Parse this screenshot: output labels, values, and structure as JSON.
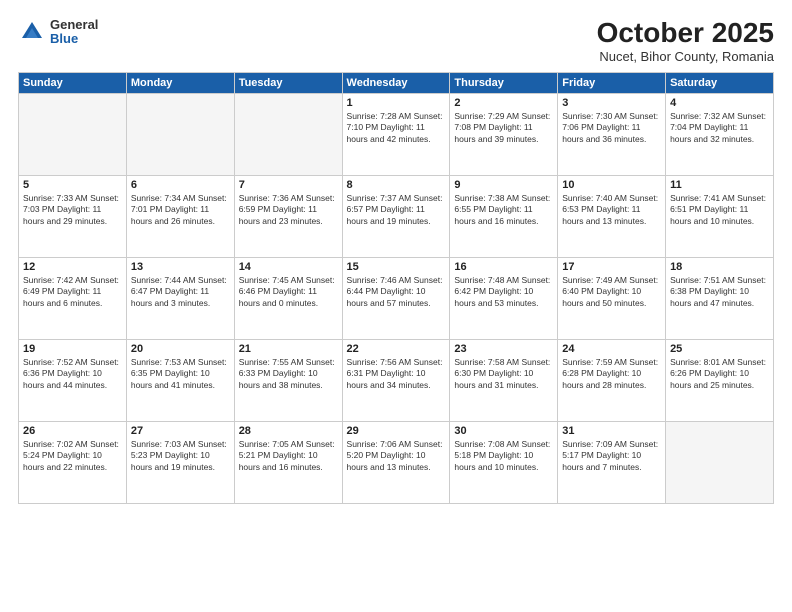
{
  "logo": {
    "general": "General",
    "blue": "Blue"
  },
  "title": "October 2025",
  "location": "Nucet, Bihor County, Romania",
  "days_header": [
    "Sunday",
    "Monday",
    "Tuesday",
    "Wednesday",
    "Thursday",
    "Friday",
    "Saturday"
  ],
  "weeks": [
    [
      {
        "day": "",
        "info": ""
      },
      {
        "day": "",
        "info": ""
      },
      {
        "day": "",
        "info": ""
      },
      {
        "day": "1",
        "info": "Sunrise: 7:28 AM\nSunset: 7:10 PM\nDaylight: 11 hours\nand 42 minutes."
      },
      {
        "day": "2",
        "info": "Sunrise: 7:29 AM\nSunset: 7:08 PM\nDaylight: 11 hours\nand 39 minutes."
      },
      {
        "day": "3",
        "info": "Sunrise: 7:30 AM\nSunset: 7:06 PM\nDaylight: 11 hours\nand 36 minutes."
      },
      {
        "day": "4",
        "info": "Sunrise: 7:32 AM\nSunset: 7:04 PM\nDaylight: 11 hours\nand 32 minutes."
      }
    ],
    [
      {
        "day": "5",
        "info": "Sunrise: 7:33 AM\nSunset: 7:03 PM\nDaylight: 11 hours\nand 29 minutes."
      },
      {
        "day": "6",
        "info": "Sunrise: 7:34 AM\nSunset: 7:01 PM\nDaylight: 11 hours\nand 26 minutes."
      },
      {
        "day": "7",
        "info": "Sunrise: 7:36 AM\nSunset: 6:59 PM\nDaylight: 11 hours\nand 23 minutes."
      },
      {
        "day": "8",
        "info": "Sunrise: 7:37 AM\nSunset: 6:57 PM\nDaylight: 11 hours\nand 19 minutes."
      },
      {
        "day": "9",
        "info": "Sunrise: 7:38 AM\nSunset: 6:55 PM\nDaylight: 11 hours\nand 16 minutes."
      },
      {
        "day": "10",
        "info": "Sunrise: 7:40 AM\nSunset: 6:53 PM\nDaylight: 11 hours\nand 13 minutes."
      },
      {
        "day": "11",
        "info": "Sunrise: 7:41 AM\nSunset: 6:51 PM\nDaylight: 11 hours\nand 10 minutes."
      }
    ],
    [
      {
        "day": "12",
        "info": "Sunrise: 7:42 AM\nSunset: 6:49 PM\nDaylight: 11 hours\nand 6 minutes."
      },
      {
        "day": "13",
        "info": "Sunrise: 7:44 AM\nSunset: 6:47 PM\nDaylight: 11 hours\nand 3 minutes."
      },
      {
        "day": "14",
        "info": "Sunrise: 7:45 AM\nSunset: 6:46 PM\nDaylight: 11 hours\nand 0 minutes."
      },
      {
        "day": "15",
        "info": "Sunrise: 7:46 AM\nSunset: 6:44 PM\nDaylight: 10 hours\nand 57 minutes."
      },
      {
        "day": "16",
        "info": "Sunrise: 7:48 AM\nSunset: 6:42 PM\nDaylight: 10 hours\nand 53 minutes."
      },
      {
        "day": "17",
        "info": "Sunrise: 7:49 AM\nSunset: 6:40 PM\nDaylight: 10 hours\nand 50 minutes."
      },
      {
        "day": "18",
        "info": "Sunrise: 7:51 AM\nSunset: 6:38 PM\nDaylight: 10 hours\nand 47 minutes."
      }
    ],
    [
      {
        "day": "19",
        "info": "Sunrise: 7:52 AM\nSunset: 6:36 PM\nDaylight: 10 hours\nand 44 minutes."
      },
      {
        "day": "20",
        "info": "Sunrise: 7:53 AM\nSunset: 6:35 PM\nDaylight: 10 hours\nand 41 minutes."
      },
      {
        "day": "21",
        "info": "Sunrise: 7:55 AM\nSunset: 6:33 PM\nDaylight: 10 hours\nand 38 minutes."
      },
      {
        "day": "22",
        "info": "Sunrise: 7:56 AM\nSunset: 6:31 PM\nDaylight: 10 hours\nand 34 minutes."
      },
      {
        "day": "23",
        "info": "Sunrise: 7:58 AM\nSunset: 6:30 PM\nDaylight: 10 hours\nand 31 minutes."
      },
      {
        "day": "24",
        "info": "Sunrise: 7:59 AM\nSunset: 6:28 PM\nDaylight: 10 hours\nand 28 minutes."
      },
      {
        "day": "25",
        "info": "Sunrise: 8:01 AM\nSunset: 6:26 PM\nDaylight: 10 hours\nand 25 minutes."
      }
    ],
    [
      {
        "day": "26",
        "info": "Sunrise: 7:02 AM\nSunset: 5:24 PM\nDaylight: 10 hours\nand 22 minutes."
      },
      {
        "day": "27",
        "info": "Sunrise: 7:03 AM\nSunset: 5:23 PM\nDaylight: 10 hours\nand 19 minutes."
      },
      {
        "day": "28",
        "info": "Sunrise: 7:05 AM\nSunset: 5:21 PM\nDaylight: 10 hours\nand 16 minutes."
      },
      {
        "day": "29",
        "info": "Sunrise: 7:06 AM\nSunset: 5:20 PM\nDaylight: 10 hours\nand 13 minutes."
      },
      {
        "day": "30",
        "info": "Sunrise: 7:08 AM\nSunset: 5:18 PM\nDaylight: 10 hours\nand 10 minutes."
      },
      {
        "day": "31",
        "info": "Sunrise: 7:09 AM\nSunset: 5:17 PM\nDaylight: 10 hours\nand 7 minutes."
      },
      {
        "day": "",
        "info": ""
      }
    ]
  ]
}
